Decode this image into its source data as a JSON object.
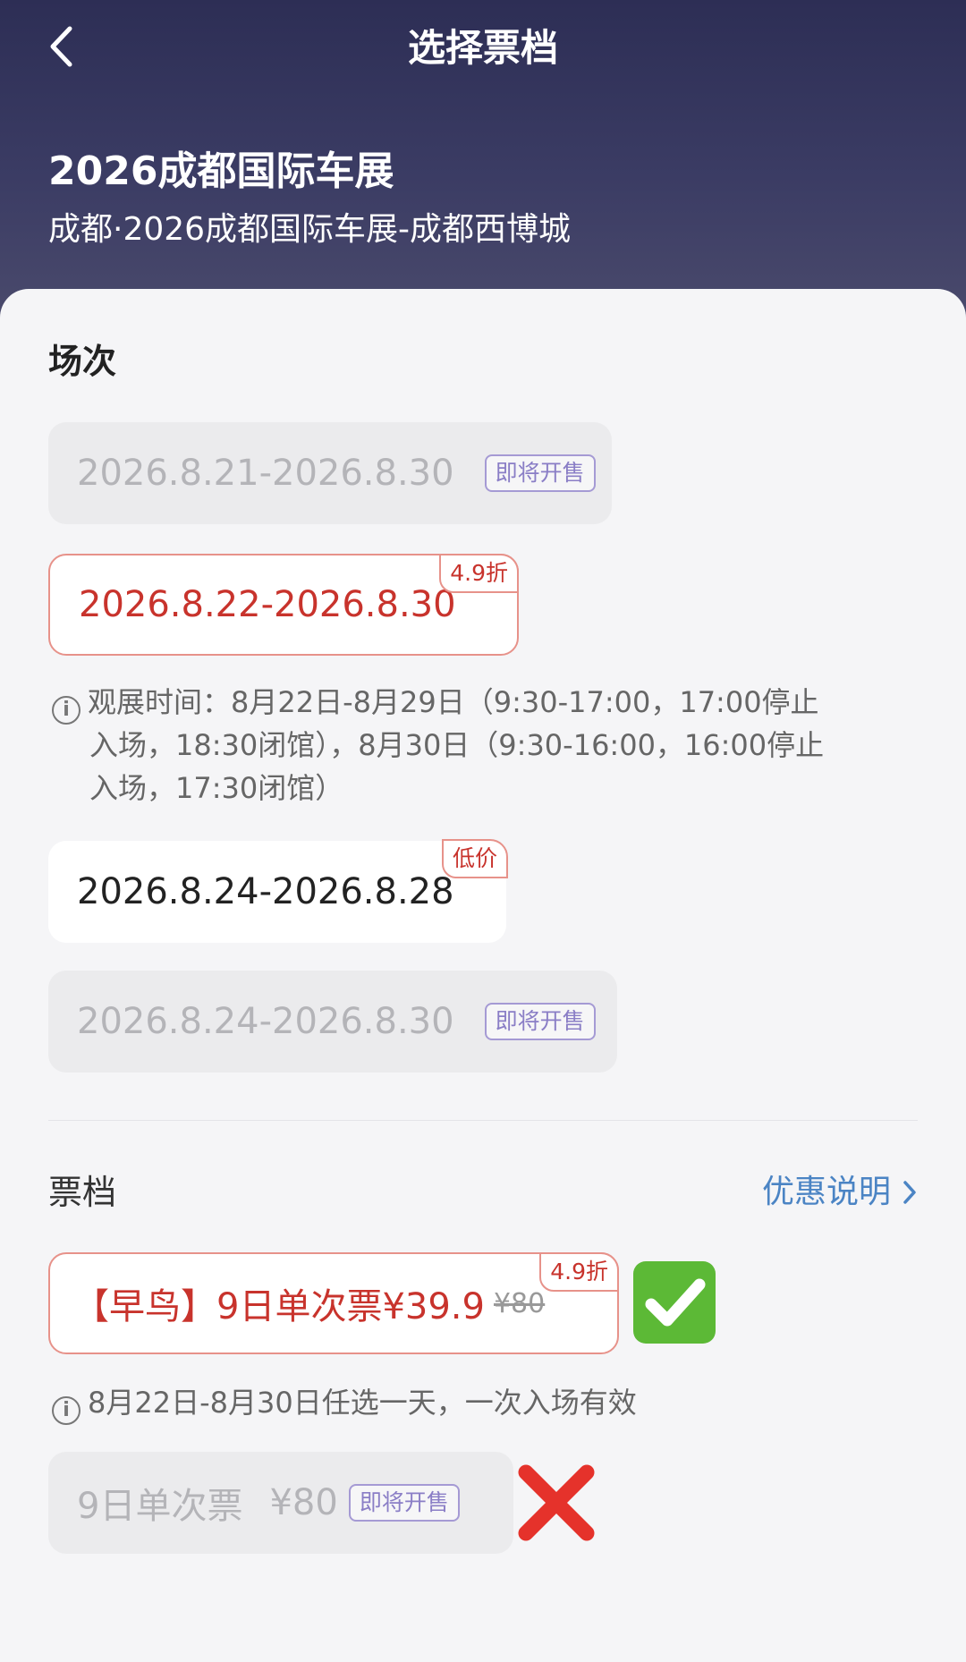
{
  "header": {
    "title": "选择票档",
    "event_title": "2026成都国际车展",
    "event_subtitle": "成都·2026成都国际车展-成都西博城"
  },
  "sessions": {
    "title": "场次",
    "items": [
      {
        "label": "2026.8.21-2026.8.30",
        "status": "即将开售",
        "state": "disabled"
      },
      {
        "label": "2026.8.22-2026.8.30",
        "tag": "4.9折",
        "state": "selected"
      },
      {
        "label": "2026.8.24-2026.8.28",
        "tag": "低价",
        "state": "normal"
      },
      {
        "label": "2026.8.24-2026.8.30",
        "status": "即将开售",
        "state": "disabled"
      }
    ],
    "note_line1": "观展时间：8月22日-8月29日（9:30-17:00，17:00停止",
    "note_line2": "入场，18:30闭馆），8月30日（9:30-16:00，16:00停止",
    "note_line3": "入场，17:30闭馆）"
  },
  "tickets": {
    "title": "票档",
    "promo_link": "优惠说明",
    "items": [
      {
        "label": "【早鸟】9日单次票¥39.9",
        "original_price": "¥80",
        "tag": "4.9折",
        "state": "selected"
      },
      {
        "label": "9日单次票",
        "price": "¥80",
        "status": "即将开售",
        "state": "disabled"
      }
    ],
    "note": "8月22日-8月30日任选一天，一次入场有效"
  },
  "icons": {
    "back": "chevron-left-icon",
    "info": "info-icon",
    "chevron_right": "chevron-right-icon",
    "check_mark": "check-mark-icon",
    "cross_mark": "cross-mark-icon"
  },
  "colors": {
    "header_bg": "#2d2e55",
    "accent_red": "#c8332c",
    "selected_border": "#e7928a",
    "soon_badge": "#8a7ec6",
    "link_blue": "#4b84c4",
    "disabled_bg": "#ebebed"
  }
}
